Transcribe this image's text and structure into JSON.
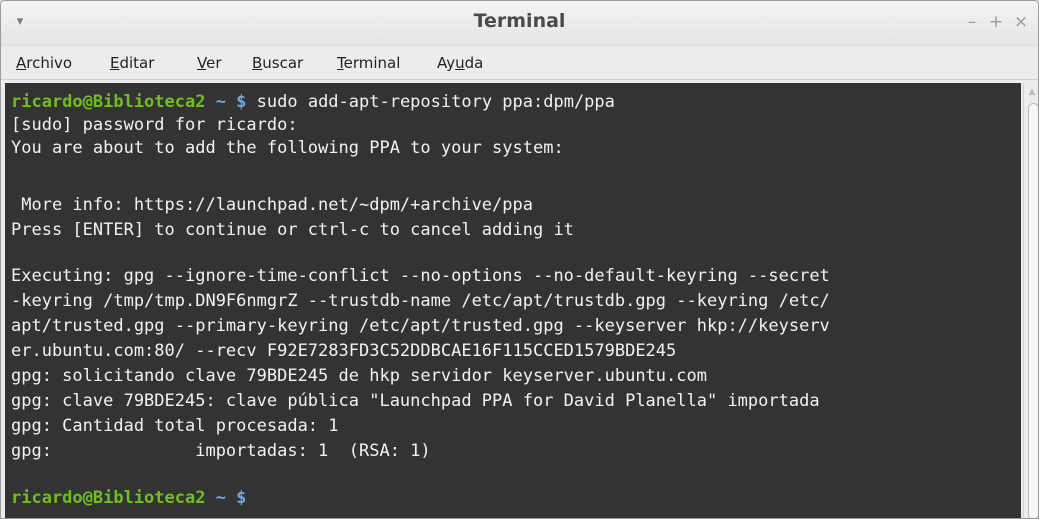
{
  "window": {
    "title": "Terminal",
    "menu_toggle_icon": "▾",
    "controls": {
      "minimize": "–",
      "maximize": "+",
      "close": "×"
    }
  },
  "menubar": {
    "items": [
      {
        "pre": "",
        "key": "A",
        "post": "rchivo"
      },
      {
        "pre": "",
        "key": "E",
        "post": "ditar"
      },
      {
        "pre": "",
        "key": "V",
        "post": "er"
      },
      {
        "pre": "",
        "key": "B",
        "post": "uscar"
      },
      {
        "pre": "",
        "key": "T",
        "post": "erminal"
      },
      {
        "pre": "Ay",
        "key": "u",
        "post": "da"
      }
    ]
  },
  "terminal": {
    "colors": {
      "background": "#333333",
      "text": "#f2f2f2",
      "user": "#6fbf1f",
      "path": "#6fa8e6"
    },
    "prompt_user": "ricardo@Biblioteca2",
    "prompt_path": " ~ $",
    "command": " sudo add-apt-repository ppa:dpm/ppa",
    "lines": [
      "[sudo] password for ricardo:",
      "You are about to add the following PPA to your system:",
      "",
      " More info: https://launchpad.net/~dpm/+archive/ppa",
      "Press [ENTER] to continue or ctrl-c to cancel adding it",
      "",
      "Executing: gpg --ignore-time-conflict --no-options --no-default-keyring --secret",
      "-keyring /tmp/tmp.DN9F6nmgrZ --trustdb-name /etc/apt/trustdb.gpg --keyring /etc/",
      "apt/trusted.gpg --primary-keyring /etc/apt/trusted.gpg --keyserver hkp://keyserv",
      "er.ubuntu.com:80/ --recv F92E7283FD3C52DDBCAE16F115CCED1579BDE245",
      "gpg: solicitando clave 79BDE245 de hkp servidor keyserver.ubuntu.com",
      "gpg: clave 79BDE245: clave pública \"Launchpad PPA for David Planella\" importada",
      "gpg: Cantidad total procesada: 1",
      "gpg:              importadas: 1  (RSA: 1)"
    ],
    "final_prompt_user": "ricardo@Biblioteca2",
    "final_prompt_path": " ~ $"
  },
  "scrollbar": {
    "up_arrow": "▲"
  }
}
